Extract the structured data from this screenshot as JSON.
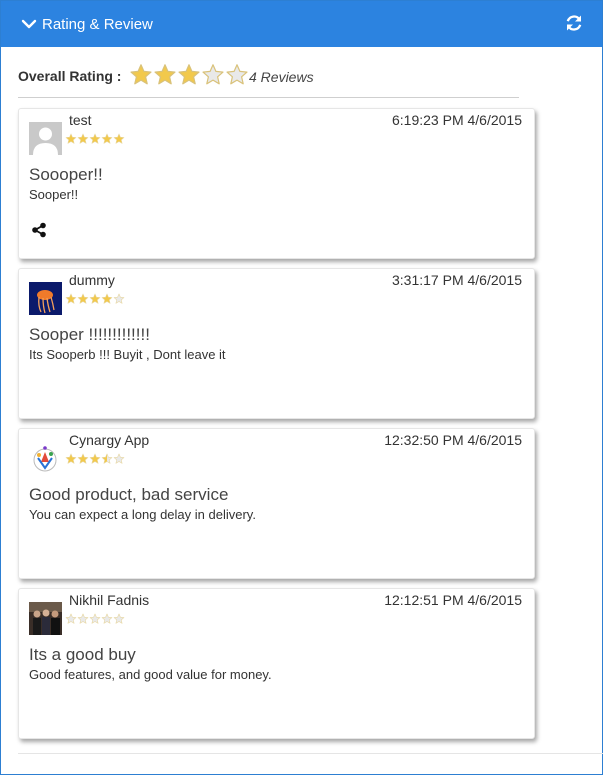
{
  "header": {
    "title": "Rating & Review",
    "collapse_icon": "chevron-down-icon",
    "refresh_icon": "refresh-icon"
  },
  "overall": {
    "label": "Overall Rating :",
    "rating": 3,
    "max": 5,
    "reviews_text": "4 Reviews"
  },
  "colors": {
    "header_bg": "#2c83e0",
    "star_fill": "#f2c94c",
    "star_empty": "#e9e9e9"
  },
  "reviews": [
    {
      "name": "test",
      "time": "6:19:23 PM 4/6/2015",
      "rating": 5,
      "title": "Soooper!!",
      "body": "Sooper!!",
      "avatar": "default-user-avatar",
      "has_share": true
    },
    {
      "name": "dummy",
      "time": "3:31:17 PM 4/6/2015",
      "rating": 4,
      "title": "Sooper !!!!!!!!!!!!!",
      "body": "Its Sooperb !!! Buyit , Dont leave it",
      "avatar": "jellyfish-avatar",
      "has_share": false
    },
    {
      "name": "Cynargy App",
      "time": "12:32:50 PM 4/6/2015",
      "rating": 3.5,
      "title": "Good product, bad service",
      "body": "You can expect a long delay in delivery.",
      "avatar": "cynargy-logo-avatar",
      "has_share": false
    },
    {
      "name": "Nikhil Fadnis",
      "time": "12:12:51 PM 4/6/2015",
      "rating": 0,
      "title": "Its a good buy",
      "body": "Good features, and good value for money.",
      "avatar": "photo-avatar",
      "has_share": false
    }
  ]
}
